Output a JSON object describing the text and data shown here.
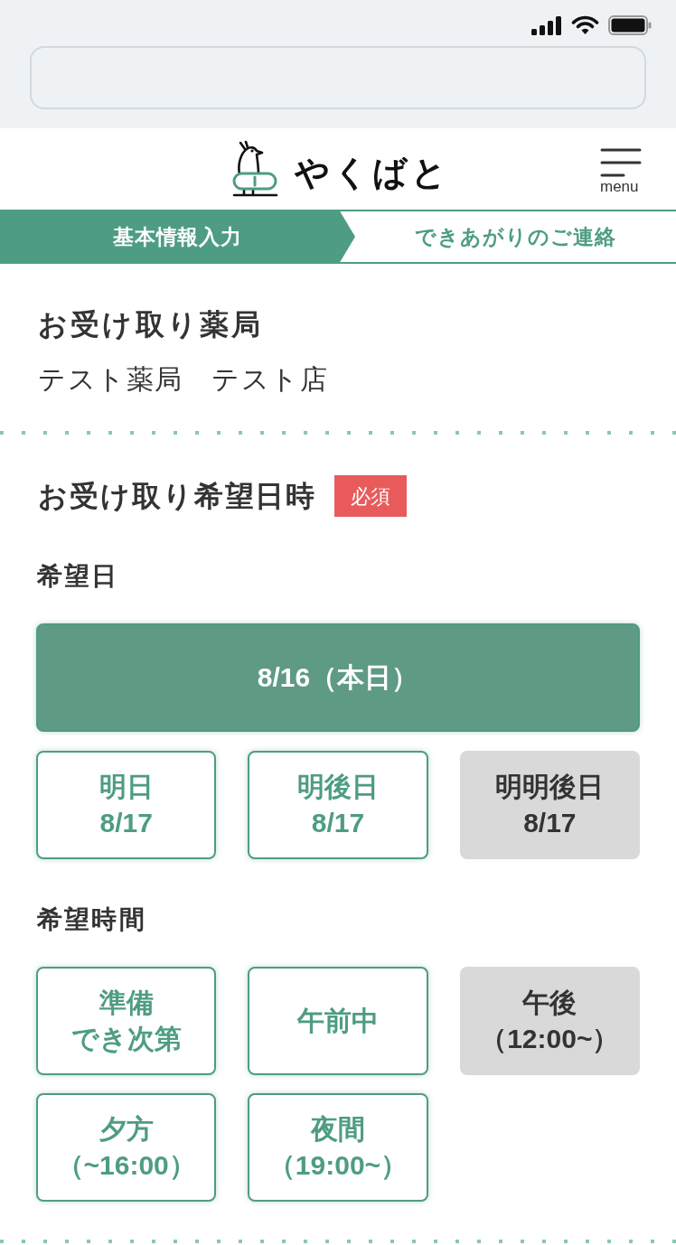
{
  "header": {
    "logo_text": "やくばと",
    "menu_label": "menu"
  },
  "steps": [
    {
      "label": "基本情報入力",
      "selected": true
    },
    {
      "label": "できあがりのご連絡",
      "selected": false
    }
  ],
  "pharmacy": {
    "title": "お受け取り薬局",
    "value": "テスト薬局　テスト店"
  },
  "pickup": {
    "title": "お受け取り希望日時",
    "badge": "必須",
    "date": {
      "label": "希望日",
      "options": [
        {
          "kind": "wide",
          "lines": [
            "8/16（本日）"
          ],
          "selected": true,
          "disabled": false
        },
        {
          "kind": "tile",
          "lines": [
            "明日",
            "8/17"
          ],
          "selected": false,
          "disabled": false
        },
        {
          "kind": "tile",
          "lines": [
            "明後日",
            "8/17"
          ],
          "selected": false,
          "disabled": false
        },
        {
          "kind": "tile",
          "lines": [
            "明明後日",
            "8/17"
          ],
          "selected": false,
          "disabled": true
        }
      ]
    },
    "time": {
      "label": "希望時間",
      "options": [
        {
          "kind": "tile",
          "lines": [
            "準備",
            "でき次第"
          ],
          "selected": false,
          "disabled": false
        },
        {
          "kind": "tile",
          "lines": [
            "午前中"
          ],
          "selected": false,
          "disabled": false
        },
        {
          "kind": "tile",
          "lines": [
            "午後",
            "（12:00~）"
          ],
          "selected": false,
          "disabled": true
        },
        {
          "kind": "tile",
          "lines": [
            "夕方",
            "（~16:00）"
          ],
          "selected": false,
          "disabled": false
        },
        {
          "kind": "tile",
          "lines": [
            "夜間",
            "（19:00~）"
          ],
          "selected": false,
          "disabled": false
        }
      ]
    }
  }
}
